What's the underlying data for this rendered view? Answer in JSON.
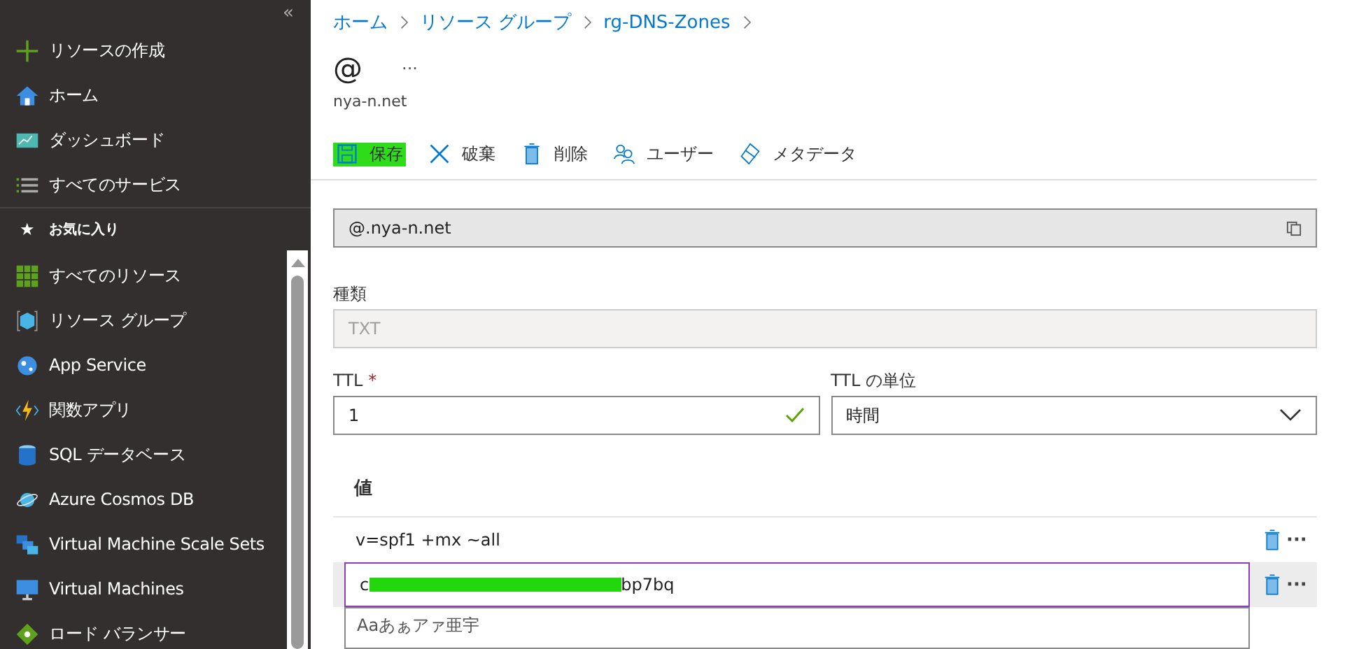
{
  "sidebar": {
    "collapse": "«",
    "items": [
      {
        "label": "リソースの作成"
      },
      {
        "label": "ホーム"
      },
      {
        "label": "ダッシュボード"
      },
      {
        "label": "すべてのサービス"
      }
    ],
    "favorites_star": "★",
    "favorites_title": "お気に入り",
    "favorites": [
      {
        "label": "すべてのリソース"
      },
      {
        "label": "リソース グループ"
      },
      {
        "label": "App Service"
      },
      {
        "label": "関数アプリ"
      },
      {
        "label": "SQL データベース"
      },
      {
        "label": "Azure Cosmos DB"
      },
      {
        "label": "Virtual Machine Scale Sets"
      },
      {
        "label": "Virtual Machines"
      },
      {
        "label": "ロード バランサー"
      }
    ]
  },
  "breadcrumb": [
    "ホーム",
    "リソース グループ",
    "rg-DNS-Zones"
  ],
  "title": "@",
  "more": "···",
  "subtitle": "nya-n.net",
  "toolbar": [
    {
      "label": "保存",
      "highlighted": true
    },
    {
      "label": "破棄",
      "highlighted": false
    },
    {
      "label": "削除",
      "highlighted": false
    },
    {
      "label": "ユーザー",
      "highlighted": false
    },
    {
      "label": "メタデータ",
      "highlighted": false
    }
  ],
  "name_field": {
    "value": "@.nya-n.net"
  },
  "type_field": {
    "label": "種類",
    "value": "TXT"
  },
  "ttl": {
    "label": "TTL",
    "required": "*",
    "value": "1",
    "valid": true
  },
  "ttl_unit": {
    "label": "TTL の単位",
    "value": "時間"
  },
  "values": {
    "header": "値",
    "rows": [
      {
        "kind": "text",
        "value": "v=spf1 +mx ~all",
        "more": "···",
        "selected": false
      },
      {
        "kind": "edit",
        "prefix": "c",
        "suffix": "bp7bq",
        "more": "···",
        "selected": true
      }
    ],
    "new_row": {
      "placeholder": "Aaあぁアァ亜宇"
    }
  }
}
